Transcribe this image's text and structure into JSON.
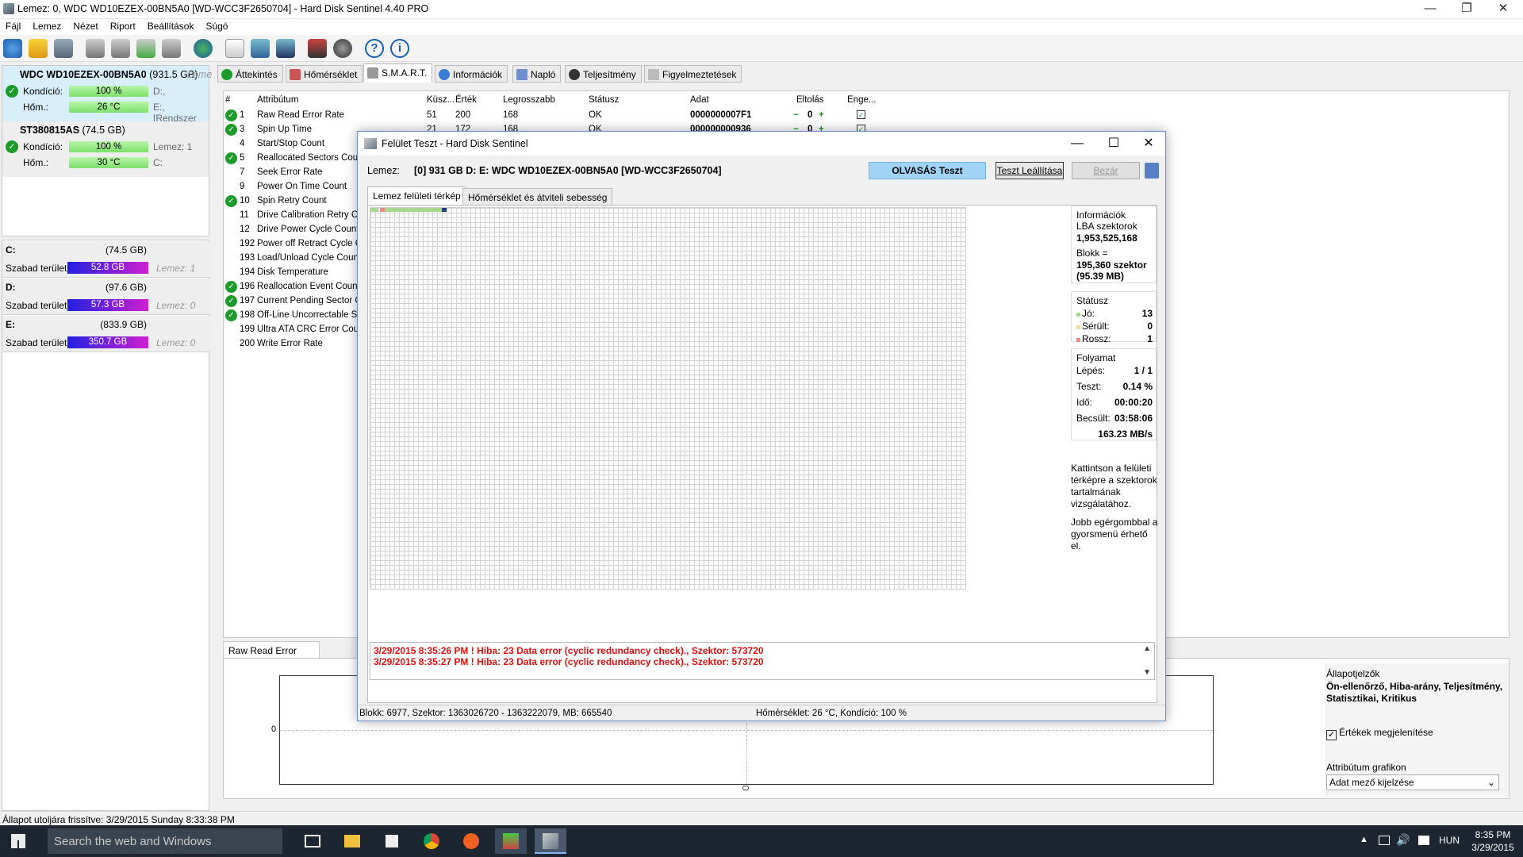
{
  "window": {
    "title": "Lemez: 0, WDC WD10EZEX-00BN5A0 [WD-WCC3F2650704] - Hard Disk Sentinel 4.40 PRO"
  },
  "menu": [
    "Fájl",
    "Lemez",
    "Nézet",
    "Riport",
    "Beállítások",
    "Súgó"
  ],
  "disks": [
    {
      "name": "WDC WD10EZEX-00BN5A0",
      "size": "(931.5 GB)",
      "tag": "Leme",
      "kond_label": "Kondíció:",
      "kond": "100 %",
      "kond_right": "D:,",
      "hom_label": "Hőm.:",
      "hom": "26 °C",
      "hom_right": "E:, [Rendszer"
    },
    {
      "name": "ST380815AS",
      "size": "(74.5 GB)",
      "kond_label": "Kondíció:",
      "kond": "100 %",
      "kond_right": "Lemez: 1",
      "hom_label": "Hőm.:",
      "hom": "30 °C",
      "hom_right": "C:"
    }
  ],
  "volumes": [
    {
      "name": "C:",
      "cap": "(74.5 GB)",
      "free_label": "Szabad terület",
      "free": "52.8 GB",
      "disk": "Lemez: 1"
    },
    {
      "name": "D:",
      "cap": "(97.6 GB)",
      "free_label": "Szabad terület",
      "free": "57.3 GB",
      "disk": "Lemez: 0"
    },
    {
      "name": "E:",
      "cap": "(833.9 GB)",
      "free_label": "Szabad terület",
      "free": "350.7 GB",
      "disk": "Lemez: 0"
    }
  ],
  "tabs": [
    "Áttekintés",
    "Hőmérséklet",
    "S.M.A.R.T.",
    "Információk",
    "Napló",
    "Teljesítmény",
    "Figyelmeztetések"
  ],
  "smart": {
    "headers": [
      "#",
      "Attribútum",
      "Küsz...",
      "Érték",
      "Legrosszabb",
      "Státusz",
      "Adat",
      "Eltolás",
      "Enge..."
    ],
    "rows": [
      {
        "id": "1",
        "name": "Raw Read Error Rate",
        "thr": "51",
        "val": "200",
        "worst": "168",
        "status": "OK",
        "data": "0000000007F1",
        "off": "0",
        "ok": true
      },
      {
        "id": "3",
        "name": "Spin Up Time",
        "thr": "21",
        "val": "172",
        "worst": "168",
        "status": "OK",
        "data": "000000000936",
        "off": "0",
        "ok": true
      },
      {
        "id": "4",
        "name": "Start/Stop Count",
        "ok": false
      },
      {
        "id": "5",
        "name": "Reallocated Sectors Cour",
        "ok": true
      },
      {
        "id": "7",
        "name": "Seek Error Rate",
        "ok": false
      },
      {
        "id": "9",
        "name": "Power On Time Count",
        "ok": false
      },
      {
        "id": "10",
        "name": "Spin Retry Count",
        "ok": true
      },
      {
        "id": "11",
        "name": "Drive Calibration Retry C",
        "ok": false
      },
      {
        "id": "12",
        "name": "Drive Power Cycle Count",
        "ok": false
      },
      {
        "id": "192",
        "name": "Power off Retract Cycle C",
        "ok": false
      },
      {
        "id": "193",
        "name": "Load/Unload Cycle Coun",
        "ok": false
      },
      {
        "id": "194",
        "name": "Disk Temperature",
        "ok": false
      },
      {
        "id": "196",
        "name": "Reallocation Event Coun",
        "ok": true
      },
      {
        "id": "197",
        "name": "Current Pending Sector C",
        "ok": true
      },
      {
        "id": "198",
        "name": "Off-Line Uncorrectable S",
        "ok": true
      },
      {
        "id": "199",
        "name": "Ultra ATA CRC Error Cour",
        "ok": false
      },
      {
        "id": "200",
        "name": "Write Error Rate",
        "ok": false
      }
    ]
  },
  "attr_chart": {
    "tab": "Raw Read Error Rate",
    "y_tick": "0"
  },
  "options": {
    "title": "Állapotjelzők",
    "desc": "Ön-ellenőrző, Hiba-arány, Teljesítmény, Statisztikai, Kritikus",
    "show_values": "Értékek megjelenítése",
    "graph_label": "Attribútum grafikon",
    "graph_select": "Adat mező kijelzése"
  },
  "statusbar": "Állapot utoljára frissítve: 3/29/2015 Sunday 8:33:38 PM",
  "taskbar": {
    "search": "Search the web and Windows",
    "lang": "HUN",
    "time": "8:35 PM",
    "date": "3/29/2015"
  },
  "dialog": {
    "title": "Felület Teszt - Hard Disk Sentinel",
    "disk_label": "Lemez:",
    "disk_value": "[0] 931 GB D: E: WDC WD10EZEX-00BN5A0 [WD-WCC3F2650704]",
    "read_btn": "OLVASÁS Teszt",
    "stop_btn": "Teszt Leállítása",
    "close_btn": "Bezár",
    "tabs": [
      "Lemez felületi térkép",
      "Hőmérséklet és átviteli sebesség"
    ],
    "info": {
      "title": "Információk",
      "lba_label": "LBA szektorok",
      "lba": "1,953,525,168",
      "block_label": "Blokk =",
      "block": "195,360 szektor",
      "block_mb": "(95.39 MB)"
    },
    "status": {
      "title": "Státusz",
      "good_label": "Jó:",
      "good": "13",
      "damaged_label": "Sérült:",
      "damaged": "0",
      "bad_label": "Rossz:",
      "bad": "1"
    },
    "progress": {
      "title": "Folyamat",
      "step_label": "Lépés:",
      "step": "1 / 1",
      "test_label": "Teszt:",
      "test": "0.14 %",
      "time_label": "Idő:",
      "time": "00:00:20",
      "est_label": "Becsült:",
      "est": "03:58:06",
      "speed": "163.23 MB/s"
    },
    "hint1": "Kattintson a felületi térképre a szektorok tartalmának vizsgálatához.",
    "hint2": "Jobb egérgombbal a gyorsmenü érhető el.",
    "log": [
      "3/29/2015  8:35:26 PM ! Hiba: 23 Data error (cyclic redundancy check)., Szektor: 573720",
      "3/29/2015  8:35:27 PM ! Hiba: 23 Data error (cyclic redundancy check)., Szektor: 573720"
    ],
    "status_left": "Blokk: 6977, Szektor: 1363026720 - 1363222079, MB: 665540",
    "status_right": "Hőmérséklet: 26  °C,  Kondíció: 100 %"
  }
}
